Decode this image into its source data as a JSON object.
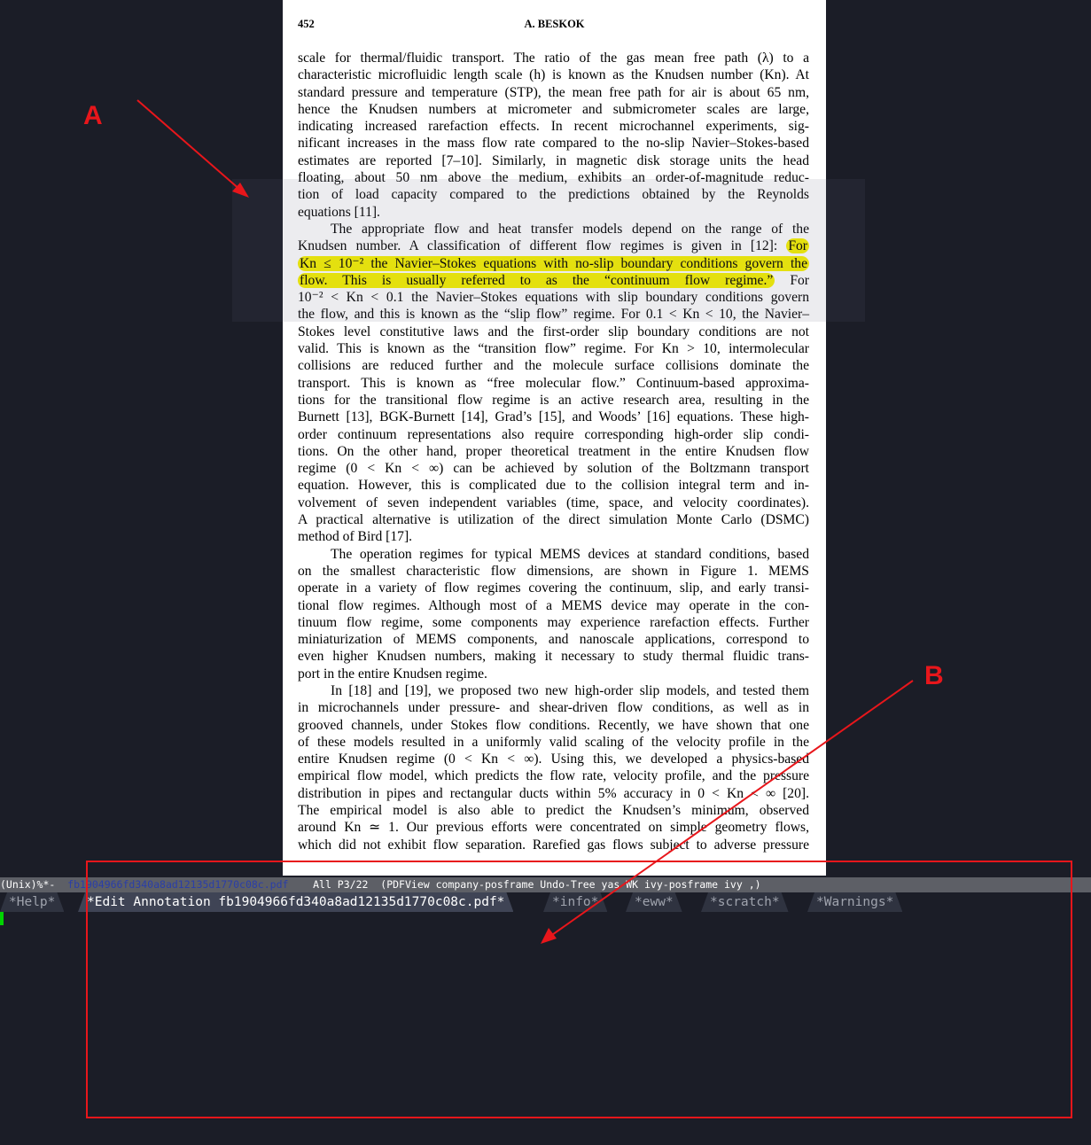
{
  "document": {
    "page_number": "452",
    "running_head": "A. BESKOK",
    "lines": [
      "scale for thermal/fluidic transport. The ratio of the gas mean free path (λ) to a",
      "characteristic microfluidic length scale (h) is known as the Knudsen number (Kn). At",
      "standard pressure and temperature (STP), the mean free path for air is about 65 nm,",
      "hence the Knudsen numbers at micrometer and submicrometer scales are large,",
      "indicating increased rarefaction effects. In recent microchannel experiments, sig-",
      "nificant increases in the mass flow rate compared to the no-slip Navier–Stokes-based",
      "estimates are reported [7–10]. Similarly, in magnetic disk storage units the head",
      "floating, about 50 nm above the medium, exhibits an order-of-magnitude reduc-",
      "tion of load capacity compared to the predictions obtained by the Reynolds",
      "equations [11].",
      "The appropriate flow and heat transfer models depend on the range of the",
      "Knudsen number. A classification of different flow regimes is given in [12]:",
      "For",
      "Kn ≤ 10⁻² the Navier–Stokes equations with no-slip boundary conditions govern the",
      "flow. This is usually referred to as the “continuum flow regime.”",
      "For",
      "10⁻² < Kn < 0.1 the Navier–Stokes equations with slip boundary conditions govern",
      "the flow, and this is known as the “slip flow” regime. For 0.1 < Kn < 10, the Navier–",
      "Stokes level constitutive laws and the first-order slip boundary conditions are not",
      "valid. This is known as the “transition flow” regime. For Kn > 10, intermolecular",
      "collisions are reduced further and the molecule surface collisions dominate the",
      "transport. This is known as “free molecular flow.” Continuum-based approxima-",
      "tions for the transitional flow regime is an active research area, resulting in the",
      "Burnett [13], BGK-Burnett [14], Grad’s [15], and Woods’ [16] equations. These high-",
      "order continuum representations also require corresponding high-order slip condi-",
      "tions. On the other hand, proper theoretical treatment in the entire Knudsen flow",
      "regime (0 < Kn < ∞) can be achieved by solution of the Boltzmann transport",
      "equation. However, this is complicated due to the collision integral term and in-",
      "volvement of seven independent variables (time, space, and velocity coordinates).",
      "A practical alternative is utilization of the direct simulation Monte Carlo (DSMC)",
      "method of Bird [17].",
      "The operation regimes for typical MEMS devices at standard conditions, based",
      "on the smallest characteristic flow dimensions, are shown in Figure 1. MEMS",
      "operate in a variety of flow regimes covering the continuum, slip, and early transi-",
      "tional flow regimes. Although most of a MEMS device may operate in the con-",
      "tinuum flow regime, some components may experience rarefaction effects. Further",
      "miniaturization of MEMS components, and nanoscale applications, correspond to",
      "even higher Knudsen numbers, making it necessary to study thermal fluidic trans-",
      "port in the entire Knudsen regime.",
      "In [18] and [19], we proposed two new high-order slip models, and tested them",
      "in microchannels under pressure- and shear-driven flow conditions, as well as in",
      "grooved channels, under Stokes flow conditions. Recently, we have shown that one",
      "of these models resulted in a uniformly valid scaling of the velocity profile in the",
      "entire Knudsen regime (0 < Kn < ∞). Using this, we developed a physics-based",
      "empirical flow model, which predicts the flow rate, velocity profile, and the pressure",
      "distribution in pipes and rectangular ducts within 5% accuracy in 0 < Kn < ∞ [20].",
      "The empirical model is also able to predict the Knudsen’s minimum, observed",
      "around Kn ≃ 1. Our previous efforts were concentrated on simple geometry flows,",
      "which did not exhibit flow separation. Rarefied gas flows subject to adverse pressure"
    ]
  },
  "modeline": {
    "prefix": "(Unix)%*-  ",
    "filename": "fb1904966fd340a8ad12135d1770c08c.pdf",
    "position": "    All P3/22  ",
    "modes": "(PDFView company-posframe Undo-Tree yas WK ivy-posframe ivy ,)"
  },
  "tabs": [
    {
      "label": "*Help*",
      "active": false
    },
    {
      "label": "*Edit Annotation fb1904966fd340a8ad12135d1770c08c.pdf*",
      "active": true
    },
    {
      "label": "*info*",
      "active": false
    },
    {
      "label": "*eww*",
      "active": false
    },
    {
      "label": "*scratch*",
      "active": false
    },
    {
      "label": "*Warnings*",
      "active": false
    }
  ],
  "annotations": {
    "label_a": "A",
    "label_b": "B",
    "color": "#e8161b"
  },
  "colors": {
    "background": "#1b1d27",
    "highlight": "#f6f200",
    "cursor": "#00d400",
    "modeline": "#5d5f66"
  }
}
